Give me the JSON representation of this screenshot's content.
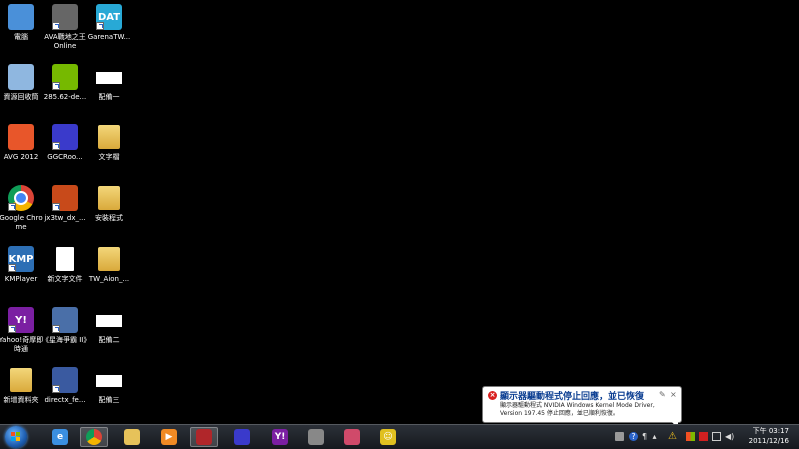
{
  "desktop": {
    "icons": [
      {
        "label": "電腦",
        "icon": "computer-icon",
        "color": "#4a90d9"
      },
      {
        "label": "AVA戰地之王Online",
        "icon": "ava-game-icon",
        "color": "#666666"
      },
      {
        "label": "GarenaTW...",
        "icon": "garena-icon",
        "color": "#28a9d6",
        "badge": "DAT"
      },
      {
        "label": "資源回收筒",
        "icon": "recycle-bin-icon",
        "color": "#8fb7e0"
      },
      {
        "label": "285.62-de...",
        "icon": "nvidia-icon",
        "color": "#76b900"
      },
      {
        "label": "配備一",
        "icon": "blank-file-icon",
        "color": "#ffffff"
      },
      {
        "label": "AVG 2012",
        "icon": "avg-icon",
        "color": "#e8562a"
      },
      {
        "label": "GGCRoo...",
        "icon": "ggc-icon",
        "color": "#3a3acb"
      },
      {
        "label": "文字檔",
        "icon": "folder-icon",
        "color": "#e6c25a"
      },
      {
        "label": "Google Chrome",
        "icon": "chrome-icon",
        "color": "#db4437"
      },
      {
        "label": "jx3tw_dx_...",
        "icon": "jx3-icon",
        "color": "#c84a1a"
      },
      {
        "label": "安裝程式",
        "icon": "folder-icon",
        "color": "#e6c25a"
      },
      {
        "label": "KMPlayer",
        "icon": "kmplayer-icon",
        "color": "#2d6fb5",
        "badge": "KMP"
      },
      {
        "label": "新文字文件",
        "icon": "text-document-icon",
        "color": "#ffffff"
      },
      {
        "label": "TW_Aion_...",
        "icon": "folder-icon",
        "color": "#e6c25a"
      },
      {
        "label": "Yahoo!奇摩即時通",
        "icon": "yahoo-messenger-icon",
        "color": "#7b1fa2",
        "badge": "Y!"
      },
      {
        "label": "《星海爭霸 II》",
        "icon": "starcraft-icon",
        "color": "#4a6fa8"
      },
      {
        "label": "配備二",
        "icon": "blank-file-icon",
        "color": "#ffffff"
      },
      {
        "label": "新增資料夾",
        "icon": "folder-icon",
        "color": "#e6c25a"
      },
      {
        "label": "directx_fe...",
        "icon": "directx-icon",
        "color": "#3a5aa0"
      },
      {
        "label": "配備三",
        "icon": "blank-file-icon",
        "color": "#ffffff"
      }
    ]
  },
  "taskbar": {
    "start": "start-button-icon",
    "items": [
      {
        "name": "internet-explorer-icon",
        "glyph": "e",
        "color": "#3b8fe0",
        "active": false
      },
      {
        "name": "chrome-taskbar-icon",
        "glyph": "",
        "color": "#db4437",
        "active": true
      },
      {
        "name": "explorer-icon",
        "glyph": "",
        "color": "#e6c25a",
        "active": false
      },
      {
        "name": "media-player-icon",
        "glyph": "▶",
        "color": "#f08a24",
        "active": false
      },
      {
        "name": "ava-taskbar-icon",
        "glyph": "",
        "color": "#b0262a",
        "active": true
      },
      {
        "name": "ggc-taskbar-icon",
        "glyph": "",
        "color": "#3a3acb",
        "active": false
      },
      {
        "name": "yahoo-taskbar-icon",
        "glyph": "Y!",
        "color": "#7b1fa2",
        "active": false
      },
      {
        "name": "ava-game-taskbar-icon",
        "glyph": "",
        "color": "#888888",
        "active": false
      },
      {
        "name": "app-taskbar-icon",
        "glyph": "",
        "color": "#d04a6a",
        "active": false
      },
      {
        "name": "emoticon-taskbar-icon",
        "glyph": "☺",
        "color": "#e0c020",
        "active": false
      }
    ],
    "tray": {
      "time": "下午 03:17",
      "date": "2011/12/16"
    }
  },
  "notification": {
    "title": "顯示器驅動程式停止回應，並已恢復",
    "body": "顯示器驅動程式 NVIDIA Windows Kernel Mode Driver, Version 197.45 停止回應，並已順利恢復。",
    "accent": "#0a3d91",
    "error_color": "#d9201f"
  }
}
